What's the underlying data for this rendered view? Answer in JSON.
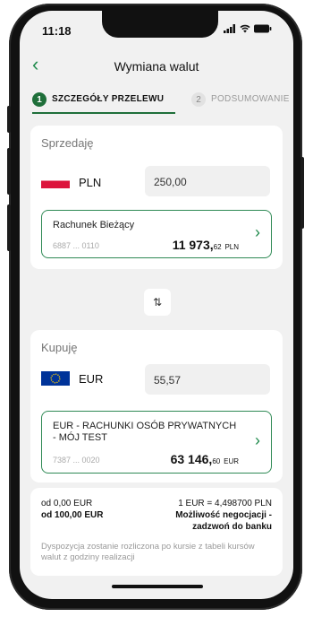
{
  "status": {
    "time": "11:18"
  },
  "header": {
    "title": "Wymiana walut",
    "back_icon": "chevron-left-icon"
  },
  "steps": [
    {
      "num": "1",
      "label": "SZCZEGÓŁY PRZELEWU",
      "active": true
    },
    {
      "num": "2",
      "label": "PODSUMOWANIE",
      "active": false
    }
  ],
  "sell": {
    "label": "Sprzedaję",
    "currency": "PLN",
    "amount": "250,00",
    "account": {
      "name": "Rachunek Bieżący",
      "number": "6887 ... 0110",
      "balance_main": "11 973,",
      "balance_dec": "62",
      "balance_ccy": "PLN"
    }
  },
  "swap_icon": "⇅",
  "buy": {
    "label": "Kupuję",
    "currency": "EUR",
    "amount": "55,57",
    "account": {
      "name_line1": "EUR - RACHUNKI OSÓB PRYWATNYCH",
      "name_line2": "- MÓJ TEST",
      "number": "7387 ... 0020",
      "balance_main": "63 146,",
      "balance_dec": "60",
      "balance_ccy": "EUR"
    }
  },
  "rate": {
    "from1": "od 0,00 EUR",
    "from2": "od 100,00 EUR",
    "rate_text": "1 EUR = 4,498700 PLN",
    "negotiation1": "Możliwość negocjacji -",
    "negotiation2": "zadzwoń do banku",
    "note": "Dyspozycja zostanie rozliczona po kursie z tabeli kursów walut z godziny realizacji"
  },
  "colors": {
    "accent": "#1f8a4c",
    "pl_flag_red": "#dc143c",
    "eu_blue": "#003399"
  }
}
